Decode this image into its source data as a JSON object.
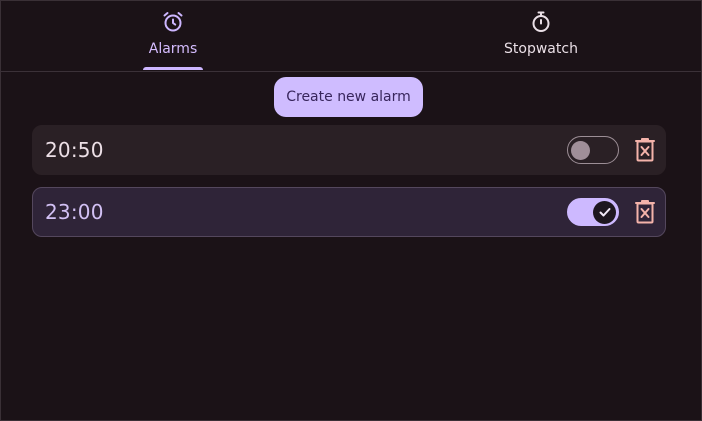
{
  "tabs": [
    {
      "label": "Alarms",
      "icon": "alarm-clock-icon",
      "selected": true
    },
    {
      "label": "Stopwatch",
      "icon": "stopwatch-icon",
      "selected": false
    }
  ],
  "create_button": {
    "label": "Create new alarm"
  },
  "alarms": [
    {
      "time": "20:50",
      "enabled": false
    },
    {
      "time": "23:00",
      "enabled": true
    }
  ],
  "colors": {
    "background": "#1b1217",
    "accent": "#cfbcff",
    "delete_icon": "#f4b3aa",
    "row_off": "#2a2025",
    "row_on": "#2f2438"
  }
}
